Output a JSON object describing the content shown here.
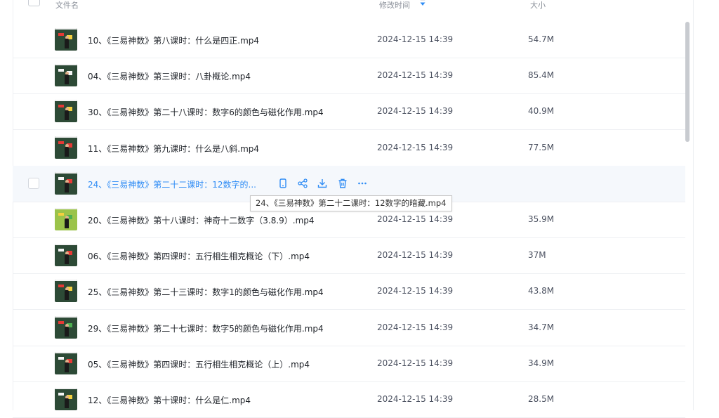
{
  "header": {
    "name_label": "文件名",
    "mtime_label": "修改时间",
    "size_label": "大小"
  },
  "colors": {
    "accent": "#2f8cf5",
    "text": "#1f2329",
    "muted": "#8a8f99",
    "row_hover": "#f5f8fc"
  },
  "rows": [
    {
      "name": "10、《三易神数》第八课时：什么是四正.mp4",
      "time": "2024-12-15 14:39",
      "size": "54.7M",
      "thumb": [
        "#2d4a36",
        "#e53935",
        "#f4d03f"
      ]
    },
    {
      "name": "04、《三易神数》第三课时：八卦概论.mp4",
      "time": "2024-12-15 14:39",
      "size": "85.4M",
      "thumb": [
        "#2d4a36",
        "#f5f5f5",
        "#f5f5f5"
      ]
    },
    {
      "name": "30、《三易神数》第二十八课时：数字6的颜色与磁化作用.mp4",
      "time": "2024-12-15 14:39",
      "size": "40.9M",
      "thumb": [
        "#2d4a36",
        "#e53935",
        "#f4d03f"
      ]
    },
    {
      "name": "11、《三易神数》第九课时：什么是八斜.mp4",
      "time": "2024-12-15 14:39",
      "size": "77.5M",
      "thumb": [
        "#2d4a36",
        "#e53935",
        "#e53935"
      ]
    },
    {
      "name": "24、《三易神数》第二十二课时：12数字的...",
      "time": "",
      "size": "",
      "thumb": [
        "#2d4a36",
        "#f5f5f5",
        "#e53935"
      ],
      "hovered": true
    },
    {
      "name": "20、《三易神数》第十八课时：神奇十二数字（3.8.9）.mp4",
      "time": "2024-12-15 14:39",
      "size": "35.9M",
      "thumb": [
        "#9bc34a",
        "#f4d03f",
        "#4caf50"
      ]
    },
    {
      "name": "06、《三易神数》第四课时：五行相生相克概论（下）.mp4",
      "time": "2024-12-15 14:39",
      "size": "37M",
      "thumb": [
        "#2d4a36",
        "#f5f5f5",
        "#e53935"
      ]
    },
    {
      "name": "25、《三易神数》第二十三课时：数字1的颜色与磁化作用.mp4",
      "time": "2024-12-15 14:39",
      "size": "43.8M",
      "thumb": [
        "#2d4a36",
        "#e53935",
        "#f4d03f"
      ]
    },
    {
      "name": "29、《三易神数》第二十七课时：数字5的颜色与磁化作用.mp4",
      "time": "2024-12-15 14:39",
      "size": "34.7M",
      "thumb": [
        "#2d4a36",
        "#e53935",
        "#4caf50"
      ]
    },
    {
      "name": "05、《三易神数》第四课时：五行相生相克概论（上）.mp4",
      "time": "2024-12-15 14:39",
      "size": "34.9M",
      "thumb": [
        "#2d4a36",
        "#f5f5f5",
        "#e53935"
      ]
    },
    {
      "name": "12、《三易神数》第十课时：什么是仁.mp4",
      "time": "2024-12-15 14:39",
      "size": "28.5M",
      "thumb": [
        "#2d4a36",
        "#f5f5f5",
        "#f4d03f"
      ]
    }
  ],
  "hover_actions": [
    "phone-icon",
    "share-icon",
    "download-icon",
    "delete-icon",
    "more-icon"
  ],
  "tooltip": "24、《三易神数》第二十二课时：12数字的暗藏.mp4"
}
